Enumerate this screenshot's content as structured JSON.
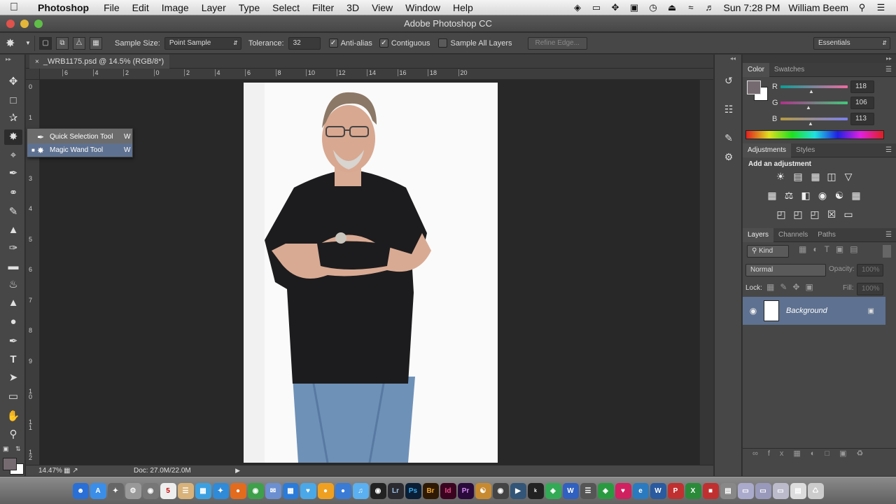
{
  "menubar": {
    "app": "Photoshop",
    "items": [
      "File",
      "Edit",
      "Image",
      "Layer",
      "Type",
      "Select",
      "Filter",
      "3D",
      "View",
      "Window",
      "Help"
    ],
    "clock": "Sun 7:28 PM",
    "user": "William Beem"
  },
  "window": {
    "title": "Adobe Photoshop CC"
  },
  "options": {
    "sample_size_label": "Sample Size:",
    "sample_size_value": "Point Sample",
    "tolerance_label": "Tolerance:",
    "tolerance_value": "32",
    "antialias_label": "Anti-alias",
    "contiguous_label": "Contiguous",
    "sample_all_label": "Sample All Layers",
    "refine_edge_label": "Refine Edge...",
    "workspace": "Essentials"
  },
  "document": {
    "tab": "_WRB1175.psd @ 14.5% (RGB/8*)",
    "zoom": "14.47%",
    "doc_size": "Doc: 27.0M/22.0M"
  },
  "rulers": {
    "h": [
      "6",
      "4",
      "2",
      "0",
      "2",
      "4",
      "6",
      "8",
      "10",
      "12",
      "14",
      "16",
      "18",
      "20"
    ],
    "v": [
      "0",
      "1",
      "2",
      "3",
      "4",
      "5",
      "6",
      "7",
      "8",
      "9",
      "1 0",
      "1 1",
      "1 2"
    ]
  },
  "flyout": [
    {
      "label": "Quick Selection Tool",
      "key": "W"
    },
    {
      "label": "Magic Wand Tool",
      "key": "W"
    }
  ],
  "color_panel": {
    "tabs": [
      "Color",
      "Swatches"
    ],
    "r_label": "R",
    "g_label": "G",
    "b_label": "B",
    "r": "118",
    "g": "106",
    "b": "113",
    "fg_color": "#766a71"
  },
  "adjustments_panel": {
    "tabs": [
      "Adjustments",
      "Styles"
    ],
    "heading": "Add an adjustment"
  },
  "layers_panel": {
    "tabs": [
      "Layers",
      "Channels",
      "Paths"
    ],
    "kind": "Kind",
    "blend": "Normal",
    "opacity_label": "Opacity:",
    "opacity": "100%",
    "lock_label": "Lock:",
    "fill_label": "Fill:",
    "fill": "100%",
    "layer_name": "Background"
  },
  "dock": {
    "apps": [
      "Lr",
      "Ps",
      "Br",
      "Id",
      "Pr"
    ]
  }
}
